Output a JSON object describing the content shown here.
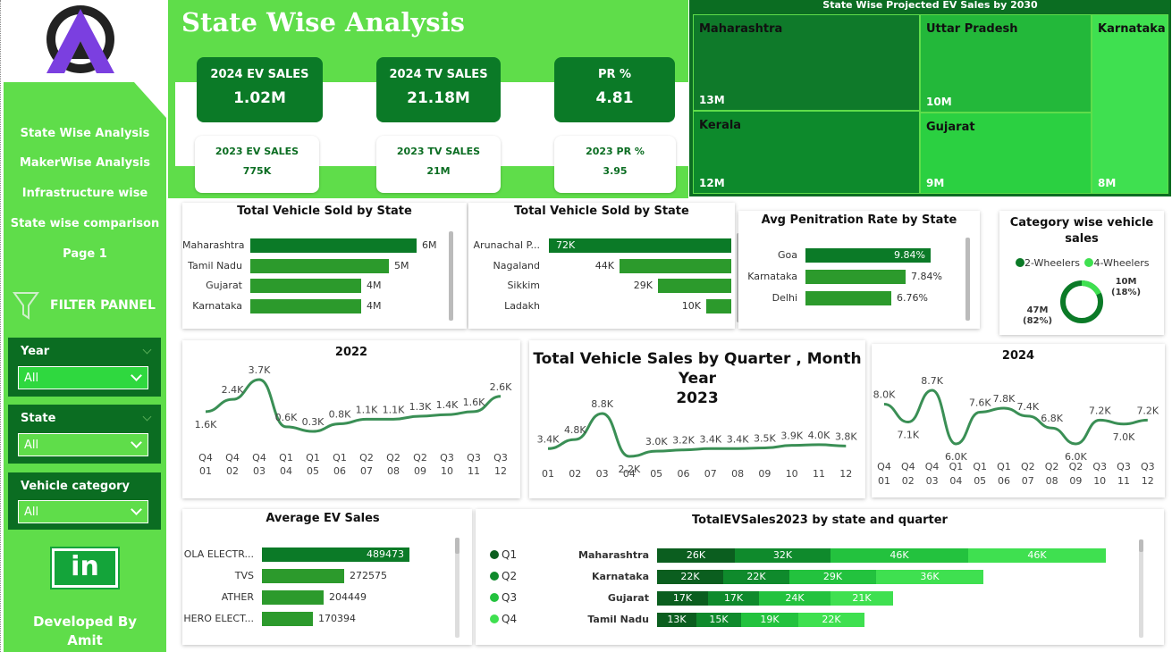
{
  "sidebar": {
    "nav": [
      "State Wise Analysis",
      "MakerWise Analysis",
      "Infrastructure wise",
      "State wise comparison",
      "Page 1"
    ],
    "filter_title": "FILTER PANNEL",
    "filters": [
      {
        "label": "Year",
        "value": "All"
      },
      {
        "label": "State",
        "value": "All"
      },
      {
        "label": "Vehicle category",
        "value": "All"
      }
    ],
    "linkedin_text": "in",
    "developer": [
      "Developed By",
      "Amit"
    ]
  },
  "header": {
    "title": "State Wise Analysis",
    "kpis": [
      {
        "label": "2024 EV SALES",
        "value": "1.02M"
      },
      {
        "label": "2024 TV SALES",
        "value": "21.18M"
      },
      {
        "label": "PR %",
        "value": "4.81"
      }
    ],
    "sub_kpis": [
      {
        "label": "2023 EV SALES",
        "value": "775K"
      },
      {
        "label": "2023 TV SALES",
        "value": "21M"
      },
      {
        "label": "2023 PR %",
        "value": "3.95"
      }
    ]
  },
  "treemap": {
    "title": "State Wise Projected EV Sales by 2030",
    "items": [
      {
        "name": "Maharashtra",
        "value": "13M",
        "color": "#0f7a2a"
      },
      {
        "name": "Kerala",
        "value": "12M",
        "color": "#0d8a2c"
      },
      {
        "name": "Uttar Pradesh",
        "value": "10M",
        "color": "#23b83a"
      },
      {
        "name": "Gujarat",
        "value": "9M",
        "color": "#2bd041"
      },
      {
        "name": "Karnataka",
        "value": "8M",
        "color": "#3fe050"
      }
    ]
  },
  "charts": {
    "vehicle_state_1": {
      "title": "Total Vehicle Sold by State",
      "rows": [
        {
          "label": "Maharashtra",
          "value": "6M",
          "n": 6
        },
        {
          "label": "Tamil Nadu",
          "value": "5M",
          "n": 5
        },
        {
          "label": "Gujarat",
          "value": "4M",
          "n": 4
        },
        {
          "label": "Karnataka",
          "value": "4M",
          "n": 4
        }
      ]
    },
    "vehicle_state_2": {
      "title": "Total Vehicle Sold by State",
      "rows": [
        {
          "label": "Arunachal P...",
          "value": "72K",
          "n": 72
        },
        {
          "label": "Nagaland",
          "value": "44K",
          "n": 44
        },
        {
          "label": "Sikkim",
          "value": "29K",
          "n": 29
        },
        {
          "label": "Ladakh",
          "value": "10K",
          "n": 10
        }
      ]
    },
    "penetration": {
      "title": "Avg Penitration Rate by State",
      "rows": [
        {
          "label": "Goa",
          "value": "9.84%",
          "n": 9.84
        },
        {
          "label": "Karnataka",
          "value": "7.84%",
          "n": 7.84
        },
        {
          "label": "Delhi",
          "value": "6.76%",
          "n": 6.76
        }
      ]
    },
    "category": {
      "title": [
        "Category wise vehicle",
        "sales"
      ],
      "legend": [
        "2-Wheelers",
        "4-Wheelers"
      ],
      "slices": [
        {
          "name": "2-Wheelers",
          "value": "47M",
          "pct": "(82%)",
          "color": "#0b7a27"
        },
        {
          "name": "4-Wheelers",
          "value": "10M",
          "pct": "(18%)",
          "color": "#3fe050"
        }
      ]
    },
    "line2022": {
      "title": "2022",
      "labels": [
        "1.6K",
        "2.4K",
        "3.7K",
        "0.6K",
        "0.3K",
        "0.8K",
        "1.1K",
        "1.1K",
        "1.3K",
        "1.4K",
        "1.6K",
        "2.6K"
      ],
      "values": [
        1.6,
        2.4,
        3.7,
        0.6,
        0.3,
        0.8,
        1.1,
        1.1,
        1.3,
        1.4,
        1.6,
        2.6
      ],
      "q": [
        "Q4",
        "Q4",
        "Q4",
        "Q1",
        "Q1",
        "Q1",
        "Q2",
        "Q2",
        "Q2",
        "Q3",
        "Q3",
        "Q3"
      ],
      "m": [
        "01",
        "02",
        "03",
        "04",
        "05",
        "06",
        "07",
        "08",
        "09",
        "10",
        "11",
        "12"
      ]
    },
    "line2023": {
      "title": [
        "Total Vehicle Sales by Quarter , Month Year",
        "2023"
      ],
      "labels": [
        "3.4K",
        "4.8K",
        "8.8K",
        "2.2K",
        "3.0K",
        "3.2K",
        "3.4K",
        "3.4K",
        "3.5K",
        "3.9K",
        "4.0K",
        "3.8K"
      ],
      "values": [
        3.4,
        4.8,
        8.8,
        2.2,
        3.0,
        3.2,
        3.4,
        3.4,
        3.5,
        3.9,
        4.0,
        3.8
      ],
      "m": [
        "01",
        "02",
        "03",
        "04",
        "05",
        "06",
        "07",
        "08",
        "09",
        "10",
        "11",
        "12"
      ]
    },
    "line2024": {
      "title": "2024",
      "labels": [
        "8.0K",
        "7.1K",
        "8.7K",
        "6.0K",
        "7.6K",
        "7.8K",
        "7.4K",
        "6.8K",
        "6.0K",
        "7.2K",
        "7.0K",
        "7.2K"
      ],
      "values": [
        8.0,
        7.1,
        8.7,
        6.0,
        7.6,
        7.8,
        7.4,
        6.8,
        6.0,
        7.2,
        7.0,
        7.2
      ],
      "q": [
        "Q4",
        "Q4",
        "Q4",
        "Q1",
        "Q1",
        "Q1",
        "Q2",
        "Q2",
        "Q2",
        "Q3",
        "Q3",
        "Q3"
      ],
      "m": [
        "01",
        "02",
        "03",
        "04",
        "05",
        "06",
        "07",
        "08",
        "09",
        "10",
        "11",
        "12"
      ]
    },
    "avg_ev": {
      "title": "Average EV Sales",
      "rows": [
        {
          "label": "OLA ELECTR...",
          "value": "489473",
          "n": 489473
        },
        {
          "label": "TVS",
          "value": "272575",
          "n": 272575
        },
        {
          "label": "ATHER",
          "value": "204449",
          "n": 204449
        },
        {
          "label": "HERO ELECT...",
          "value": "170394",
          "n": 170394
        }
      ]
    },
    "stacked": {
      "title": "TotalEVSales2023 by state and quarter",
      "legend": [
        "Q1",
        "Q2",
        "Q3",
        "Q4"
      ],
      "colors": [
        "#0b5e1f",
        "#0f8a2c",
        "#23c23e",
        "#3fe050"
      ],
      "rows": [
        {
          "label": "Maharashtra",
          "values": [
            "26K",
            "32K",
            "46K",
            "46K"
          ],
          "n": [
            26,
            32,
            46,
            46
          ]
        },
        {
          "label": "Karnataka",
          "values": [
            "22K",
            "22K",
            "29K",
            "36K"
          ],
          "n": [
            22,
            22,
            29,
            36
          ]
        },
        {
          "label": "Gujarat",
          "values": [
            "17K",
            "17K",
            "24K",
            "21K"
          ],
          "n": [
            17,
            17,
            24,
            21
          ]
        },
        {
          "label": "Tamil Nadu",
          "values": [
            "13K",
            "15K",
            "19K",
            "22K"
          ],
          "n": [
            13,
            15,
            19,
            22
          ]
        }
      ]
    }
  }
}
